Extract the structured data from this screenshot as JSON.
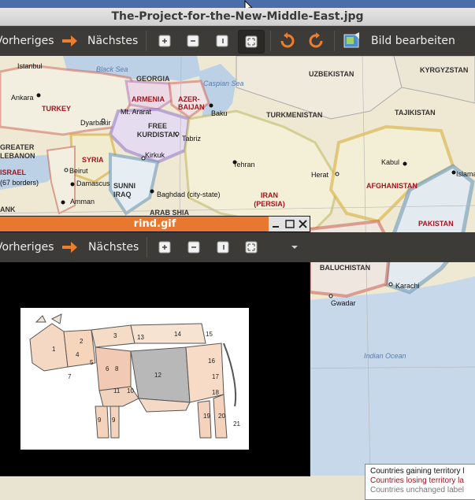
{
  "main_window": {
    "title": "The-Project-for-the-New-Middle-East.jpg",
    "toolbar": {
      "prev_label": "Vorheriges",
      "next_label": "Nächstes",
      "edit_label": "Bild bearbeiten"
    },
    "map": {
      "water": [
        "Black Sea",
        "Caspian Sea",
        "Indian Ocean"
      ],
      "regions_gain": [
        "TURKEY",
        "ARMENIA",
        "AZER-BAIJAN",
        "FREE KURDISTAN",
        "SYRIA",
        "SUNNI IRAQ",
        "IRAN (PERSIA)",
        "AFGHANISTAN",
        "PAKISTAN",
        "FREE BALUCHISTAN",
        "ISRAEL",
        "GREATER LEBANON"
      ],
      "regions_unchanged": [
        "GEORGIA",
        "UZBEKISTAN",
        "TURKMENISTAN",
        "TAJIKISTAN",
        "KYRGYZSTAN"
      ],
      "cities": [
        "Istanbul",
        "Ankara",
        "Dyarbakir",
        "Mt. Ararat",
        "Baku",
        "Tabriz",
        "Kirkuk",
        "Beirut",
        "Damascus",
        "Amman",
        "Baghdad (city-state)",
        "Tehran",
        "Herat",
        "Kabul",
        "Islama",
        "Karachi",
        "Gwadar"
      ],
      "fragments": [
        "ARAB SHIA",
        "(67 borders)",
        "ANK"
      ]
    },
    "legend": {
      "gain": "Countries gaining territory l",
      "lose": "Countries losing territory la",
      "unchanged": "Countries unchanged label"
    }
  },
  "front_window": {
    "title": "rind.gif",
    "toolbar": {
      "prev_label": "Vorheriges",
      "next_label": "Nächstes"
    },
    "cow_cuts": [
      "1",
      "2",
      "3",
      "4",
      "5",
      "6",
      "7",
      "8",
      "9",
      "9",
      "10",
      "11",
      "12",
      "13",
      "14",
      "15",
      "16",
      "17",
      "18",
      "19",
      "20",
      "21"
    ]
  },
  "colors": {
    "titlebar_active": "#e8782f",
    "toolbar_bg": "#3c3b37",
    "accent_arrow": "#f07d2a",
    "map_gain_border": "#a0141e",
    "map_water": "#bcd0e6"
  }
}
